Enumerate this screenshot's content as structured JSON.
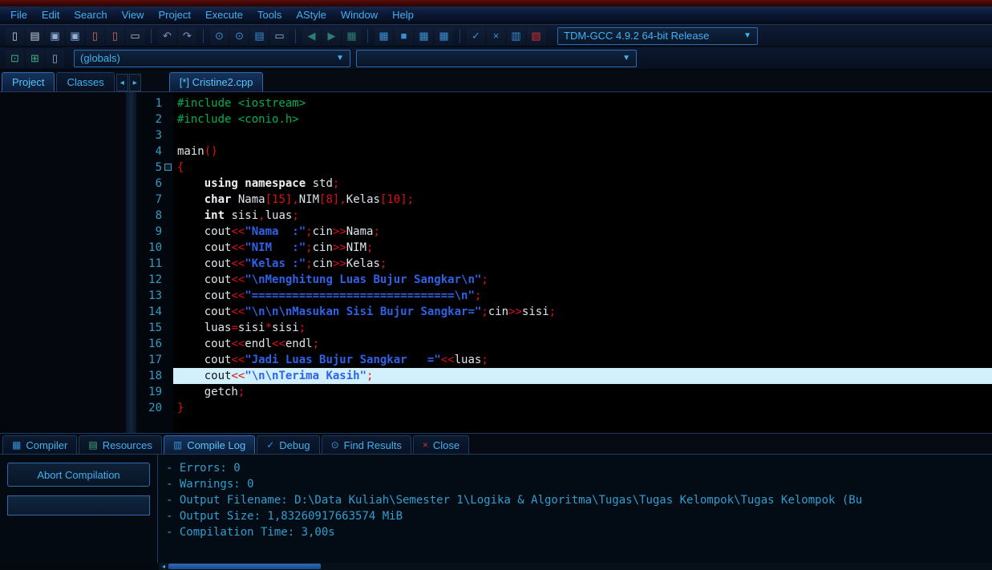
{
  "menu": {
    "items": [
      "File",
      "Edit",
      "Search",
      "View",
      "Project",
      "Execute",
      "Tools",
      "AStyle",
      "Window",
      "Help"
    ]
  },
  "toolbar": {
    "compiler_combo": "TDM-GCC 4.9.2 64-bit Release",
    "groups": [
      [
        {
          "name": "new-file",
          "glyph": "▯",
          "color": "#c8d2e0"
        },
        {
          "name": "open-file",
          "glyph": "▤",
          "color": "#c8d2e0"
        },
        {
          "name": "save",
          "glyph": "▣",
          "color": "#8fb0d8"
        },
        {
          "name": "save-all",
          "glyph": "▣",
          "color": "#8fb0d8"
        },
        {
          "name": "close-file",
          "glyph": "▯",
          "color": "#d46a6a"
        },
        {
          "name": "close-all",
          "glyph": "▯",
          "color": "#d46a6a"
        },
        {
          "name": "print",
          "glyph": "▭",
          "color": "#b0bccc"
        }
      ],
      [
        {
          "name": "undo",
          "glyph": "↶",
          "color": "#7f98b8"
        },
        {
          "name": "redo",
          "glyph": "↷",
          "color": "#7f98b8"
        }
      ],
      [
        {
          "name": "find",
          "glyph": "⊙",
          "color": "#3a8fd4"
        },
        {
          "name": "replace",
          "glyph": "⊙",
          "color": "#3a8fd4"
        },
        {
          "name": "find-in-files",
          "glyph": "▤",
          "color": "#3a8fd4"
        },
        {
          "name": "print-file",
          "glyph": "▭",
          "color": "#8fb0d8"
        }
      ],
      [
        {
          "name": "back",
          "glyph": "◀",
          "color": "#2e7d74"
        },
        {
          "name": "forward",
          "glyph": "▶",
          "color": "#2e7d74"
        },
        {
          "name": "history",
          "glyph": "▦",
          "color": "#2e7d74"
        }
      ],
      [
        {
          "name": "compile",
          "glyph": "▦",
          "color": "#3a8fd4"
        },
        {
          "name": "run",
          "glyph": "■",
          "color": "#3a8fd4"
        },
        {
          "name": "compile-run",
          "glyph": "▦",
          "color": "#3a8fd4"
        },
        {
          "name": "rebuild",
          "glyph": "▦",
          "color": "#3a8fd4"
        }
      ],
      [
        {
          "name": "debug",
          "glyph": "✓",
          "color": "#3a8fd4"
        },
        {
          "name": "abort",
          "glyph": "×",
          "color": "#3a8fd4"
        },
        {
          "name": "profile",
          "glyph": "▥",
          "color": "#3a8fd4"
        },
        {
          "name": "delete-profiling",
          "glyph": "▨",
          "color": "#d03030"
        }
      ]
    ]
  },
  "toolbar2": {
    "buttons": [
      {
        "name": "insert",
        "glyph": "⊡",
        "color": "#3fae7e"
      },
      {
        "name": "toggle-bookmark",
        "glyph": "⊞",
        "color": "#3fae7e"
      },
      {
        "name": "goto-bookmark",
        "glyph": "▯",
        "color": "#8fb0d8"
      }
    ],
    "globals_combo": "(globals)",
    "members_combo": ""
  },
  "left_panel": {
    "tabs": [
      {
        "label": "Project",
        "active": true
      },
      {
        "label": "Classes",
        "active": false
      }
    ],
    "scroll_left": "◂",
    "scroll_right": "▸"
  },
  "editor": {
    "tab_title": "[*] Cristine2.cpp",
    "active_line": 18,
    "lines": [
      {
        "num": "1",
        "tokens": [
          [
            "#include <iostream>",
            "pp"
          ]
        ]
      },
      {
        "num": "2",
        "tokens": [
          [
            "#include <conio.h>",
            "pp"
          ]
        ]
      },
      {
        "num": "3",
        "tokens": []
      },
      {
        "num": "4",
        "tokens": [
          [
            "main",
            "id"
          ],
          [
            "()",
            "pun"
          ]
        ]
      },
      {
        "num": "5",
        "fold": true,
        "tokens": [
          [
            "{",
            "pun"
          ]
        ]
      },
      {
        "num": "6",
        "tokens": [
          [
            "    ",
            "id"
          ],
          [
            "using namespace",
            "kw"
          ],
          [
            " std",
            "id"
          ],
          [
            ";",
            "pun"
          ]
        ]
      },
      {
        "num": "7",
        "tokens": [
          [
            "    ",
            "id"
          ],
          [
            "char",
            "kw"
          ],
          [
            " Nama",
            "id"
          ],
          [
            "[15]",
            "num"
          ],
          [
            ",",
            "pun"
          ],
          [
            "NIM",
            "id"
          ],
          [
            "[8]",
            "num"
          ],
          [
            ",",
            "pun"
          ],
          [
            "Kelas",
            "id"
          ],
          [
            "[10]",
            "num"
          ],
          [
            ";",
            "pun"
          ]
        ]
      },
      {
        "num": "8",
        "tokens": [
          [
            "    ",
            "id"
          ],
          [
            "int",
            "kw"
          ],
          [
            " sisi",
            "id"
          ],
          [
            ",",
            "pun"
          ],
          [
            "luas",
            "id"
          ],
          [
            ";",
            "pun"
          ]
        ]
      },
      {
        "num": "9",
        "tokens": [
          [
            "    cout",
            "id"
          ],
          [
            "<<",
            "pun"
          ],
          [
            "\"Nama  :\"",
            "str"
          ],
          [
            ";",
            "pun"
          ],
          [
            "cin",
            "id"
          ],
          [
            ">>",
            "pun"
          ],
          [
            "Nama",
            "id"
          ],
          [
            ";",
            "pun"
          ]
        ]
      },
      {
        "num": "10",
        "tokens": [
          [
            "    cout",
            "id"
          ],
          [
            "<<",
            "pun"
          ],
          [
            "\"NIM   :\"",
            "str"
          ],
          [
            ";",
            "pun"
          ],
          [
            "cin",
            "id"
          ],
          [
            ">>",
            "pun"
          ],
          [
            "NIM",
            "id"
          ],
          [
            ";",
            "pun"
          ]
        ]
      },
      {
        "num": "11",
        "tokens": [
          [
            "    cout",
            "id"
          ],
          [
            "<<",
            "pun"
          ],
          [
            "\"Kelas :\"",
            "str"
          ],
          [
            ";",
            "pun"
          ],
          [
            "cin",
            "id"
          ],
          [
            ">>",
            "pun"
          ],
          [
            "Kelas",
            "id"
          ],
          [
            ";",
            "pun"
          ]
        ]
      },
      {
        "num": "12",
        "tokens": [
          [
            "    cout",
            "id"
          ],
          [
            "<<",
            "pun"
          ],
          [
            "\"\\nMenghitung Luas Bujur Sangkar\\n\"",
            "str"
          ],
          [
            ";",
            "pun"
          ]
        ]
      },
      {
        "num": "13",
        "tokens": [
          [
            "    cout",
            "id"
          ],
          [
            "<<",
            "pun"
          ],
          [
            "\"==============================\\n\"",
            "str"
          ],
          [
            ";",
            "pun"
          ]
        ]
      },
      {
        "num": "14",
        "tokens": [
          [
            "    cout",
            "id"
          ],
          [
            "<<",
            "pun"
          ],
          [
            "\"\\n\\n\\nMasukan Sisi Bujur Sangkar=\"",
            "str"
          ],
          [
            ";",
            "pun"
          ],
          [
            "cin",
            "id"
          ],
          [
            ">>",
            "pun"
          ],
          [
            "sisi",
            "id"
          ],
          [
            ";",
            "pun"
          ]
        ]
      },
      {
        "num": "15",
        "tokens": [
          [
            "    luas",
            "id"
          ],
          [
            "=",
            "pun"
          ],
          [
            "sisi",
            "id"
          ],
          [
            "*",
            "pun"
          ],
          [
            "sisi",
            "id"
          ],
          [
            ";",
            "pun"
          ]
        ]
      },
      {
        "num": "16",
        "tokens": [
          [
            "    cout",
            "id"
          ],
          [
            "<<",
            "pun"
          ],
          [
            "endl",
            "id"
          ],
          [
            "<<",
            "pun"
          ],
          [
            "endl",
            "id"
          ],
          [
            ";",
            "pun"
          ]
        ]
      },
      {
        "num": "17",
        "tokens": [
          [
            "    cout",
            "id"
          ],
          [
            "<<",
            "pun"
          ],
          [
            "\"Jadi Luas Bujur Sangkar   =\"",
            "str"
          ],
          [
            "<<",
            "pun"
          ],
          [
            "luas",
            "id"
          ],
          [
            ";",
            "pun"
          ]
        ]
      },
      {
        "num": "18",
        "tokens": [
          [
            "    cout",
            "id"
          ],
          [
            "<<",
            "pun"
          ],
          [
            "\"\\n\\nTerima Kasih\"",
            "str"
          ],
          [
            ";",
            "pun"
          ]
        ]
      },
      {
        "num": "19",
        "tokens": [
          [
            "    getch",
            "id"
          ],
          [
            ";",
            "pun"
          ]
        ]
      },
      {
        "num": "20",
        "tokens": [
          [
            "}",
            "pun"
          ]
        ]
      }
    ]
  },
  "bottom": {
    "tabs": [
      {
        "label": "Compiler",
        "icon": "compiler-grid-icon",
        "glyph": "▦",
        "color": "#3a8fd4",
        "active": false
      },
      {
        "label": "Resources",
        "icon": "resources-icon",
        "glyph": "▤",
        "color": "#3fae7e",
        "active": false
      },
      {
        "label": "Compile Log",
        "icon": "compile-log-chart-icon",
        "glyph": "▥",
        "color": "#3a8fd4",
        "active": true
      },
      {
        "label": "Debug",
        "icon": "debug-check-icon",
        "glyph": "✓",
        "color": "#3a8fd4",
        "active": false
      },
      {
        "label": "Find Results",
        "icon": "find-results-search-icon",
        "glyph": "⊙",
        "color": "#3a8fd4",
        "active": false
      },
      {
        "label": "Close",
        "icon": "close-x-icon",
        "glyph": "×",
        "color": "#d03030",
        "active": false
      }
    ],
    "abort_label": "Abort Compilation",
    "log_lines": [
      "- Errors: 0",
      "- Warnings: 0",
      "- Output Filename: D:\\Data Kuliah\\Semester 1\\Logika & Algoritma\\Tugas\\Tugas Kelompok\\Tugas Kelompok (Bu",
      "- Output Size: 1,83260917663574 MiB",
      "- Compilation Time: 3,00s"
    ]
  }
}
